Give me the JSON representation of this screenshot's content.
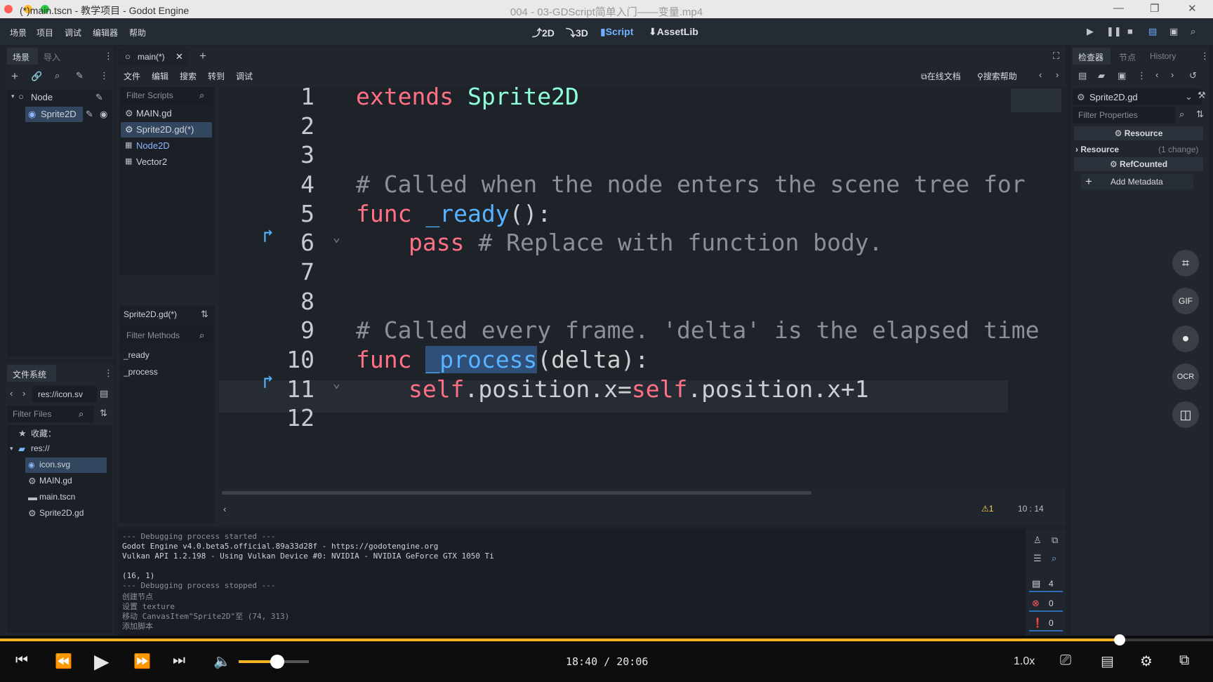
{
  "window": {
    "title": "(*)main.tscn - 教学项目 - Godot Engine",
    "video_title": "004 - 03-GDScript简单入门——变量.mp4"
  },
  "menu": [
    "场景",
    "项目",
    "调试",
    "编辑器",
    "帮助"
  ],
  "workspaces": [
    {
      "label": "2D",
      "icon": "2d-icon"
    },
    {
      "label": "3D",
      "icon": "3d-icon"
    },
    {
      "label": "Script",
      "icon": "script-icon"
    },
    {
      "label": "AssetLib",
      "icon": "assetlib-icon"
    }
  ],
  "scene_panel": {
    "tabs": [
      "场景",
      "导入"
    ],
    "tree": [
      {
        "label": "Node",
        "icon": "node-icon"
      },
      {
        "label": "Sprite2D",
        "icon": "sprite-icon"
      }
    ]
  },
  "filesystem": {
    "title": "文件系统",
    "path": "res://icon.sv",
    "filter_placeholder": "Filter Files",
    "favorites": "收藏：",
    "root": "res://",
    "files": [
      "icon.svg",
      "MAIN.gd",
      "main.tscn",
      "Sprite2D.gd"
    ]
  },
  "script_editor": {
    "tab": "main(*)",
    "menu": [
      "文件",
      "编辑",
      "搜索",
      "转到",
      "调试"
    ],
    "online_docs": "在线文档",
    "search_help": "搜索帮助",
    "filter_scripts": "Filter Scripts",
    "scripts": [
      "MAIN.gd",
      "Sprite2D.gd(*)",
      "Node2D",
      "Vector2"
    ],
    "current_script": "Sprite2D.gd(*)",
    "filter_methods": "Filter Methods",
    "methods": [
      "_ready",
      "_process"
    ],
    "warnings": "1",
    "cursor": "10 :  14",
    "line_numbers": [
      "1",
      "2",
      "3",
      "4",
      "5",
      "6",
      "7",
      "8",
      "9",
      "10",
      "11",
      "12"
    ],
    "code": {
      "l1_kw": "extends",
      "l1_cls": "Sprite2D",
      "l4": "# Called when the node enters the scene tree for",
      "l5_kw": "func",
      "l5_fn": "_ready",
      "l5_rest": "():",
      "l6_kw": "pass",
      "l6_cm": "# Replace with function body.",
      "l9": "# Called every frame. 'delta' is the elapsed time",
      "l10_kw": "func",
      "l10_fn": "_process",
      "l10_rest": "(delta):",
      "l11_self1": "self",
      "l11_mid": ".position.x=",
      "l11_self2": "self",
      "l11_end": ".position.x+1"
    }
  },
  "inspector": {
    "tabs": [
      "检查器",
      "节点",
      "History"
    ],
    "resource_name": "Sprite2D.gd",
    "filter_placeholder": "Filter Properties",
    "section_resource": "Resource",
    "row_resource": "Resource",
    "row_resource_note": "(1 change)",
    "section_refcounted": "RefCounted",
    "add_metadata": "Add Metadata"
  },
  "output": {
    "lines": [
      "--- Debugging process started ---",
      "Godot Engine v4.0.beta5.official.89a33d28f - https://godotengine.org",
      "Vulkan API 1.2.198 - Using Vulkan Device #0: NVIDIA - NVIDIA GeForce GTX 1050 Ti",
      "",
      "(16, 1)",
      "--- Debugging process stopped ---",
      "创建节点",
      "设置 texture",
      "移动 CanvasItem\"Sprite2D\"至 (74, 313)",
      "添加脚本"
    ],
    "counts": {
      "messages": "4",
      "errors": "0",
      "warnings": "0"
    }
  },
  "side_tools": [
    "crop-icon",
    "GIF",
    "camera-icon",
    "OCR",
    "layout-icon"
  ],
  "video": {
    "time": "18:40 / 20:06",
    "speed": "1.0x",
    "progress": 0.923,
    "volume": 0.55
  },
  "colors": {
    "keyword": "#ff7085",
    "class": "#8effda",
    "function": "#57b3ff",
    "comment": "#8a8f98",
    "accent": "#6fb2ff",
    "progress": "#f5b324"
  }
}
